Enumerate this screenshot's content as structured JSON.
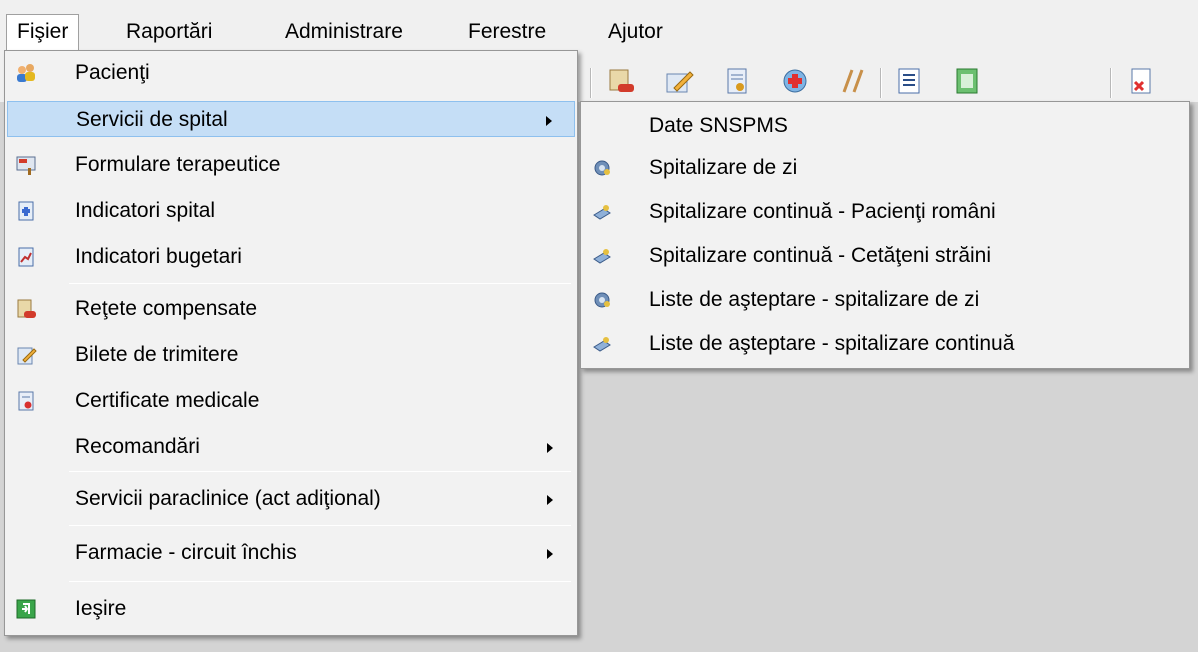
{
  "menubar": {
    "items": [
      {
        "label": "Fişier"
      },
      {
        "label": "Raportări"
      },
      {
        "label": "Administrare"
      },
      {
        "label": "Ferestre"
      },
      {
        "label": "Ajutor"
      }
    ]
  },
  "file_menu": {
    "items": [
      {
        "label": "Pacienţi",
        "icon": "patients-icon"
      },
      {
        "label": "Servicii de spital",
        "icon": "none",
        "submenu": true
      },
      {
        "label": "Formulare terapeutice",
        "icon": "forms-icon"
      },
      {
        "label": "Indicatori spital",
        "icon": "hospital-indicators-icon"
      },
      {
        "label": "Indicatori bugetari",
        "icon": "budget-indicators-icon"
      },
      {
        "label": "Reţete compensate",
        "icon": "prescriptions-icon"
      },
      {
        "label": "Bilete de trimitere",
        "icon": "referrals-icon"
      },
      {
        "label": "Certificate medicale",
        "icon": "certificates-icon"
      },
      {
        "label": "Recomandări",
        "icon": "none",
        "submenu": true
      },
      {
        "label": "Servicii paraclinice (act adiţional)",
        "icon": "none",
        "submenu": true
      },
      {
        "label": "Farmacie - circuit închis",
        "icon": "none",
        "submenu": true
      },
      {
        "label": "Ieşire",
        "icon": "exit-icon"
      }
    ]
  },
  "hospital_submenu": {
    "items": [
      {
        "label": "Date SNSPMS",
        "icon": "none"
      },
      {
        "label": "Spitalizare de zi",
        "icon": "day-hospitalization-icon"
      },
      {
        "label": "Spitalizare continuă - Pacienţi români",
        "icon": "continuous-hospitalization-icon"
      },
      {
        "label": "Spitalizare continuă - Cetăţeni străini",
        "icon": "continuous-hospitalization-icon"
      },
      {
        "label": "Liste de aşteptare - spitalizare de zi",
        "icon": "day-hospitalization-icon"
      },
      {
        "label": "Liste de aşteptare - spitalizare continuă",
        "icon": "continuous-hospitalization-icon"
      }
    ]
  },
  "colors": {
    "highlight": "#c5def6",
    "menu_background": "#f2f2f2",
    "workspace": "#d4d4d4"
  }
}
